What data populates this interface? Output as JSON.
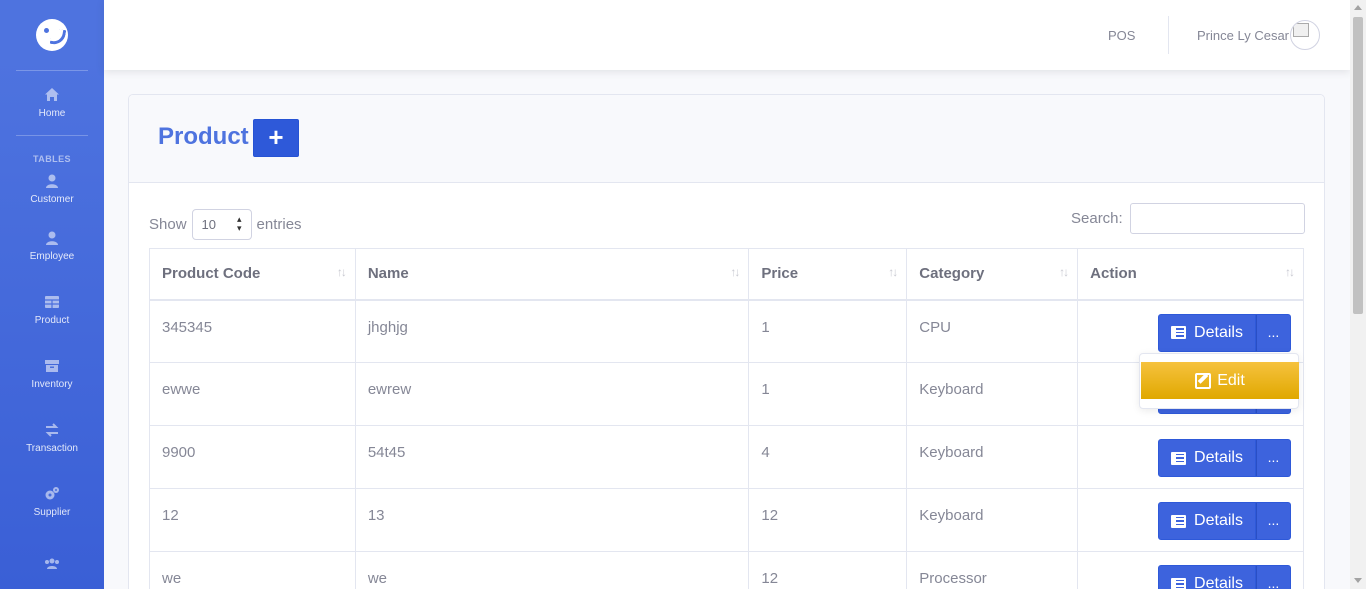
{
  "sidebar": {
    "brand_icon": "smiley-logo-icon",
    "home": {
      "label": "Home",
      "icon": "home-icon"
    },
    "heading": "TABLES",
    "items": [
      {
        "label": "Customer",
        "icon": "user-icon"
      },
      {
        "label": "Employee",
        "icon": "user-icon"
      },
      {
        "label": "Product",
        "icon": "table-icon"
      },
      {
        "label": "Inventory",
        "icon": "archive-icon"
      },
      {
        "label": "Transaction",
        "icon": "exchange-icon"
      },
      {
        "label": "Supplier",
        "icon": "cogs-icon"
      },
      {
        "label": "",
        "icon": "users-icon"
      }
    ]
  },
  "topbar": {
    "pos_label": "POS",
    "user_name": "Prince Ly Cesar"
  },
  "card": {
    "title": "Product",
    "add_label": "+"
  },
  "datatable": {
    "show_label": "Show",
    "entries_value": "10",
    "entries_label": "entries",
    "search_label": "Search:",
    "columns": [
      "Product Code",
      "Name",
      "Price",
      "Category",
      "Action"
    ],
    "rows": [
      {
        "code": "345345",
        "name": "jhghjg",
        "price": "1",
        "category": "CPU"
      },
      {
        "code": "ewwe",
        "name": "ewrew",
        "price": "1",
        "category": "Keyboard"
      },
      {
        "code": "9900",
        "name": "54t45",
        "price": "4",
        "category": "Keyboard"
      },
      {
        "code": "12",
        "name": "13",
        "price": "12",
        "category": "Keyboard"
      },
      {
        "code": "we",
        "name": "we",
        "price": "12",
        "category": "Processor"
      }
    ],
    "details_label": "Details",
    "more_label": "...",
    "edit_label": "Edit"
  },
  "colors": {
    "primary": "#4e73df",
    "warning": "#f6c23e"
  }
}
